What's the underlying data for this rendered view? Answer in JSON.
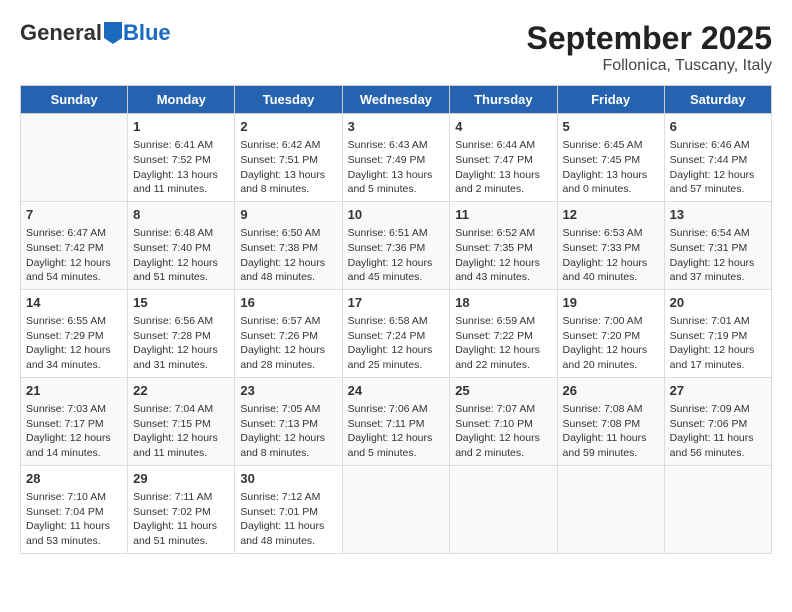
{
  "header": {
    "logo_general": "General",
    "logo_blue": "Blue",
    "title": "September 2025",
    "subtitle": "Follonica, Tuscany, Italy"
  },
  "weekdays": [
    "Sunday",
    "Monday",
    "Tuesday",
    "Wednesday",
    "Thursday",
    "Friday",
    "Saturday"
  ],
  "weeks": [
    [
      {
        "day": "",
        "lines": []
      },
      {
        "day": "1",
        "lines": [
          "Sunrise: 6:41 AM",
          "Sunset: 7:52 PM",
          "Daylight: 13 hours",
          "and 11 minutes."
        ]
      },
      {
        "day": "2",
        "lines": [
          "Sunrise: 6:42 AM",
          "Sunset: 7:51 PM",
          "Daylight: 13 hours",
          "and 8 minutes."
        ]
      },
      {
        "day": "3",
        "lines": [
          "Sunrise: 6:43 AM",
          "Sunset: 7:49 PM",
          "Daylight: 13 hours",
          "and 5 minutes."
        ]
      },
      {
        "day": "4",
        "lines": [
          "Sunrise: 6:44 AM",
          "Sunset: 7:47 PM",
          "Daylight: 13 hours",
          "and 2 minutes."
        ]
      },
      {
        "day": "5",
        "lines": [
          "Sunrise: 6:45 AM",
          "Sunset: 7:45 PM",
          "Daylight: 13 hours",
          "and 0 minutes."
        ]
      },
      {
        "day": "6",
        "lines": [
          "Sunrise: 6:46 AM",
          "Sunset: 7:44 PM",
          "Daylight: 12 hours",
          "and 57 minutes."
        ]
      }
    ],
    [
      {
        "day": "7",
        "lines": [
          "Sunrise: 6:47 AM",
          "Sunset: 7:42 PM",
          "Daylight: 12 hours",
          "and 54 minutes."
        ]
      },
      {
        "day": "8",
        "lines": [
          "Sunrise: 6:48 AM",
          "Sunset: 7:40 PM",
          "Daylight: 12 hours",
          "and 51 minutes."
        ]
      },
      {
        "day": "9",
        "lines": [
          "Sunrise: 6:50 AM",
          "Sunset: 7:38 PM",
          "Daylight: 12 hours",
          "and 48 minutes."
        ]
      },
      {
        "day": "10",
        "lines": [
          "Sunrise: 6:51 AM",
          "Sunset: 7:36 PM",
          "Daylight: 12 hours",
          "and 45 minutes."
        ]
      },
      {
        "day": "11",
        "lines": [
          "Sunrise: 6:52 AM",
          "Sunset: 7:35 PM",
          "Daylight: 12 hours",
          "and 43 minutes."
        ]
      },
      {
        "day": "12",
        "lines": [
          "Sunrise: 6:53 AM",
          "Sunset: 7:33 PM",
          "Daylight: 12 hours",
          "and 40 minutes."
        ]
      },
      {
        "day": "13",
        "lines": [
          "Sunrise: 6:54 AM",
          "Sunset: 7:31 PM",
          "Daylight: 12 hours",
          "and 37 minutes."
        ]
      }
    ],
    [
      {
        "day": "14",
        "lines": [
          "Sunrise: 6:55 AM",
          "Sunset: 7:29 PM",
          "Daylight: 12 hours",
          "and 34 minutes."
        ]
      },
      {
        "day": "15",
        "lines": [
          "Sunrise: 6:56 AM",
          "Sunset: 7:28 PM",
          "Daylight: 12 hours",
          "and 31 minutes."
        ]
      },
      {
        "day": "16",
        "lines": [
          "Sunrise: 6:57 AM",
          "Sunset: 7:26 PM",
          "Daylight: 12 hours",
          "and 28 minutes."
        ]
      },
      {
        "day": "17",
        "lines": [
          "Sunrise: 6:58 AM",
          "Sunset: 7:24 PM",
          "Daylight: 12 hours",
          "and 25 minutes."
        ]
      },
      {
        "day": "18",
        "lines": [
          "Sunrise: 6:59 AM",
          "Sunset: 7:22 PM",
          "Daylight: 12 hours",
          "and 22 minutes."
        ]
      },
      {
        "day": "19",
        "lines": [
          "Sunrise: 7:00 AM",
          "Sunset: 7:20 PM",
          "Daylight: 12 hours",
          "and 20 minutes."
        ]
      },
      {
        "day": "20",
        "lines": [
          "Sunrise: 7:01 AM",
          "Sunset: 7:19 PM",
          "Daylight: 12 hours",
          "and 17 minutes."
        ]
      }
    ],
    [
      {
        "day": "21",
        "lines": [
          "Sunrise: 7:03 AM",
          "Sunset: 7:17 PM",
          "Daylight: 12 hours",
          "and 14 minutes."
        ]
      },
      {
        "day": "22",
        "lines": [
          "Sunrise: 7:04 AM",
          "Sunset: 7:15 PM",
          "Daylight: 12 hours",
          "and 11 minutes."
        ]
      },
      {
        "day": "23",
        "lines": [
          "Sunrise: 7:05 AM",
          "Sunset: 7:13 PM",
          "Daylight: 12 hours",
          "and 8 minutes."
        ]
      },
      {
        "day": "24",
        "lines": [
          "Sunrise: 7:06 AM",
          "Sunset: 7:11 PM",
          "Daylight: 12 hours",
          "and 5 minutes."
        ]
      },
      {
        "day": "25",
        "lines": [
          "Sunrise: 7:07 AM",
          "Sunset: 7:10 PM",
          "Daylight: 12 hours",
          "and 2 minutes."
        ]
      },
      {
        "day": "26",
        "lines": [
          "Sunrise: 7:08 AM",
          "Sunset: 7:08 PM",
          "Daylight: 11 hours",
          "and 59 minutes."
        ]
      },
      {
        "day": "27",
        "lines": [
          "Sunrise: 7:09 AM",
          "Sunset: 7:06 PM",
          "Daylight: 11 hours",
          "and 56 minutes."
        ]
      }
    ],
    [
      {
        "day": "28",
        "lines": [
          "Sunrise: 7:10 AM",
          "Sunset: 7:04 PM",
          "Daylight: 11 hours",
          "and 53 minutes."
        ]
      },
      {
        "day": "29",
        "lines": [
          "Sunrise: 7:11 AM",
          "Sunset: 7:02 PM",
          "Daylight: 11 hours",
          "and 51 minutes."
        ]
      },
      {
        "day": "30",
        "lines": [
          "Sunrise: 7:12 AM",
          "Sunset: 7:01 PM",
          "Daylight: 11 hours",
          "and 48 minutes."
        ]
      },
      {
        "day": "",
        "lines": []
      },
      {
        "day": "",
        "lines": []
      },
      {
        "day": "",
        "lines": []
      },
      {
        "day": "",
        "lines": []
      }
    ]
  ]
}
